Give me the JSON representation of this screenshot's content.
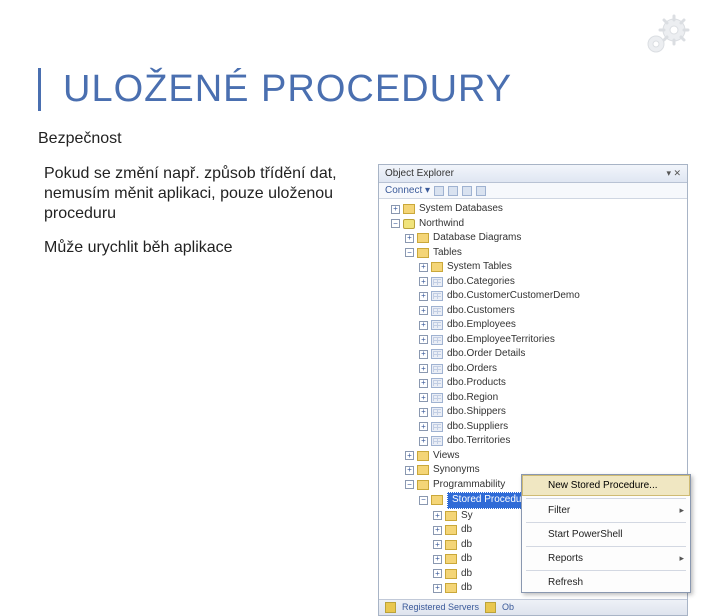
{
  "corner_icon": "gears-icon",
  "title": "ULOŽENÉ PROCEDURY",
  "subtitle": "Bezpečnost",
  "paragraphs": [
    "Pokud se změní např. způsob třídění dat, nemusím měnit aplikaci, pouze uloženou proceduru",
    "Může urychlit běh aplikace"
  ],
  "explorer": {
    "panel_title": "Object Explorer",
    "connect_label": "Connect ▾",
    "tree": {
      "system_databases": "System Databases",
      "northwind": "Northwind",
      "database_diagrams": "Database Diagrams",
      "tables_label": "Tables",
      "tables": [
        "System Tables",
        "dbo.Categories",
        "dbo.CustomerCustomerDemo",
        "dbo.Customers",
        "dbo.Employees",
        "dbo.EmployeeTerritories",
        "dbo.Order Details",
        "dbo.Orders",
        "dbo.Products",
        "dbo.Region",
        "dbo.Shippers",
        "dbo.Suppliers",
        "dbo.Territories"
      ],
      "views": "Views",
      "synonyms": "Synonyms",
      "programmability": "Programmability",
      "stored_procedures": "Stored Procedures",
      "sub_sy": "Sy",
      "sub_db": [
        "db",
        "db",
        "db",
        "db",
        "db"
      ]
    },
    "context_menu": {
      "new_sp": "New Stored Procedure...",
      "filter": "Filter",
      "start_ps": "Start PowerShell",
      "reports": "Reports",
      "refresh": "Refresh"
    },
    "statusbar": {
      "registered": "Registered Servers",
      "obj": "Ob"
    }
  }
}
